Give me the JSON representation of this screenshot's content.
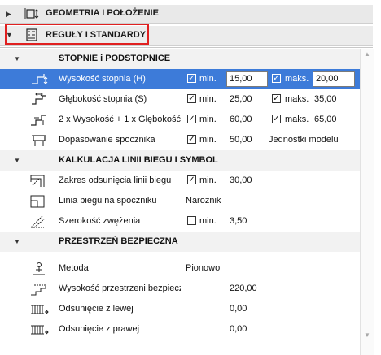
{
  "headers": [
    {
      "title": "GEOMETRIA I POŁOŻENIE",
      "icon": "geometry-icon",
      "collapsed": true
    },
    {
      "title": "REGUŁY I STANDARDY",
      "icon": "rules-icon",
      "collapsed": false
    }
  ],
  "sections": {
    "stopnie": {
      "title": "STOPNIE i PODSTOPNICE"
    },
    "kalkulacja": {
      "title": "KALKULACJA LINII BIEGU I SYMBOL"
    },
    "przestrzen": {
      "title": "PRZESTRZEŃ BEZPIECZNA"
    }
  },
  "rows": {
    "wysokosc": {
      "label": "Wysokość stopnia (H)",
      "min_label": "min.",
      "min_value": "15,00",
      "max_label": "maks.",
      "max_value": "20,00",
      "min_checked": true,
      "max_checked": true
    },
    "glebokosc": {
      "label": "Głębokość stopnia (S)",
      "min_label": "min.",
      "min_value": "25,00",
      "max_label": "maks.",
      "max_value": "35,00",
      "min_checked": true,
      "max_checked": true
    },
    "formula": {
      "label": "2 x Wysokość + 1 x Głębokość",
      "min_label": "min.",
      "min_value": "60,00",
      "max_label": "maks.",
      "max_value": "65,00",
      "min_checked": true,
      "max_checked": true
    },
    "dopasowanie": {
      "label": "Dopasowanie spocznika",
      "min_label": "min.",
      "min_value": "50,00",
      "unit": "Jednostki modelu",
      "min_checked": true
    },
    "zakres": {
      "label": "Zakres odsunięcia linii biegu",
      "min_label": "min.",
      "min_value": "30,00",
      "min_checked": true
    },
    "linia": {
      "label": "Linia biegu na spoczniku",
      "value": "Narożnik"
    },
    "szerokosc": {
      "label": "Szerokość zwężenia",
      "min_label": "min.",
      "min_value": "3,50",
      "min_checked": false
    },
    "metoda": {
      "label": "Metoda",
      "value": "Pionowo"
    },
    "wysokosc_przestrzeni": {
      "label": "Wysokość przestrzeni bezpiecznej",
      "value": "220,00"
    },
    "odsuniecie_lewej": {
      "label": "Odsunięcie z lewej",
      "value": "0,00"
    },
    "odsuniecie_prawej": {
      "label": "Odsunięcie z prawej",
      "value": "0,00"
    }
  },
  "colors": {
    "selection": "#3d7bd9",
    "highlight_box": "#e02020"
  }
}
